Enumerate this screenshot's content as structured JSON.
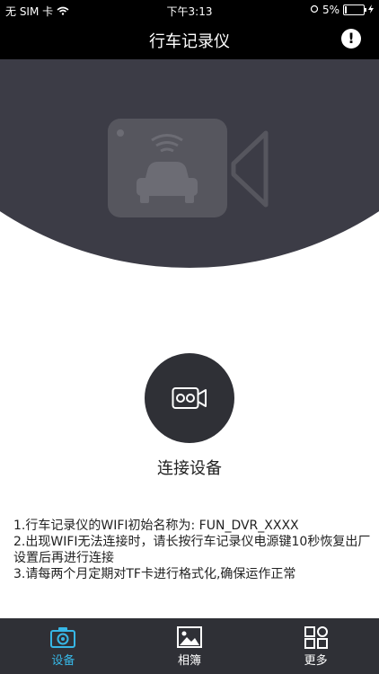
{
  "status": {
    "carrier": "无 SIM 卡",
    "time": "下午3:13",
    "battery": "5%",
    "battery_level": 0.05
  },
  "nav": {
    "title": "行车记录仪"
  },
  "connect": {
    "label": "连接设备"
  },
  "instructions": {
    "line1": "1.行车记录仪的WIFI初始名称为: FUN_DVR_XXXX",
    "line2": "2.出现WIFI无法连接时，请长按行车记录仪电源键10秒恢复出厂设置后再进行连接",
    "line3": "3.请每两个月定期对TF卡进行格式化,确保运作正常"
  },
  "tabs": [
    {
      "label": "设备",
      "icon": "camera-icon",
      "active": true
    },
    {
      "label": "相簿",
      "icon": "image-icon",
      "active": false
    },
    {
      "label": "更多",
      "icon": "grid-icon",
      "active": false
    }
  ],
  "colors": {
    "accent": "#37b7e6",
    "tabbar": "#2f3036",
    "hero": "#3c3c46"
  }
}
